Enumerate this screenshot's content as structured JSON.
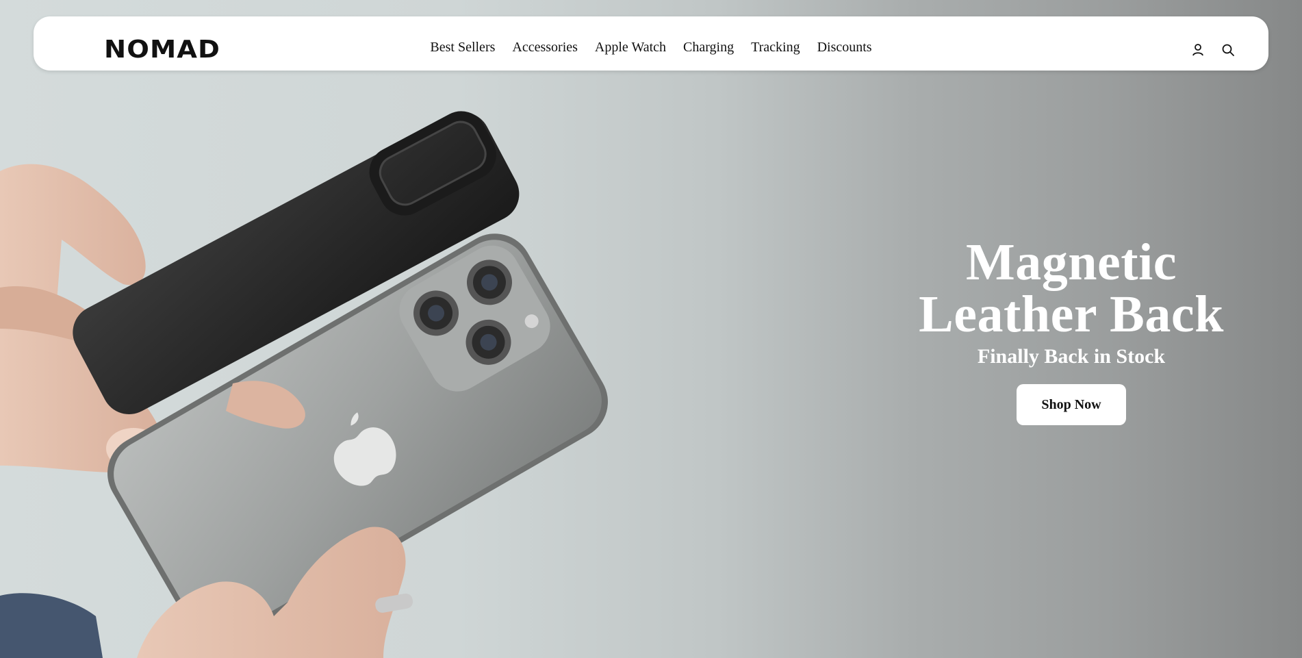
{
  "brand": {
    "logo_text": "NOMAD"
  },
  "nav": {
    "items": [
      {
        "label": "Best Sellers"
      },
      {
        "label": "Accessories"
      },
      {
        "label": "Apple Watch"
      },
      {
        "label": "Charging"
      },
      {
        "label": "Tracking"
      },
      {
        "label": "Discounts"
      }
    ],
    "icons": [
      "account-icon",
      "search-icon"
    ]
  },
  "hero": {
    "title_line1": "Magnetic",
    "title_line2": "Leather Back",
    "subtitle": "Finally Back in Stock",
    "cta_label": "Shop Now"
  },
  "colors": {
    "background_light": "#d4dbdb",
    "background_dark": "#868888",
    "nav_bg": "#ffffff",
    "hero_text": "#ffffff",
    "button_bg": "#ffffff",
    "button_text": "#111111"
  }
}
